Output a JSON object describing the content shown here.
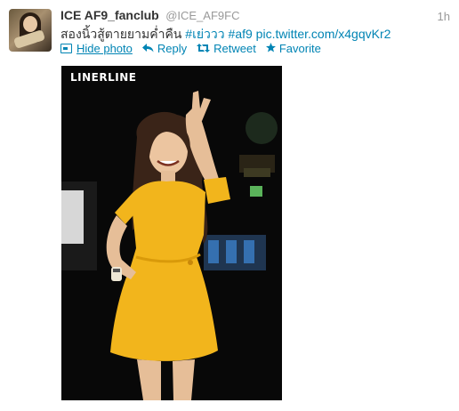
{
  "tweet": {
    "fullname": "ICE AF9_fanclub",
    "username": "@ICE_AF9FC",
    "time": "1h",
    "text_plain": "สองนิ้วสู้ตายยามค่ำคืน ",
    "hashtag1": "#เย่ววว",
    "hashtag2": "#af9",
    "pic_link": "pic.twitter.com/x4gqvKr2"
  },
  "actions": {
    "hide_photo": "Hide photo",
    "reply": "Reply",
    "retweet": "Retweet",
    "favorite": "Favorite"
  },
  "media": {
    "watermark": "LINERLINE"
  },
  "icons": {
    "photo": "photo-icon",
    "reply": "reply-icon",
    "retweet": "retweet-icon",
    "favorite": "star-icon"
  },
  "colors": {
    "link": "#0084b4",
    "muted": "#999999",
    "text": "#333333",
    "dress": "#f2b51c"
  }
}
